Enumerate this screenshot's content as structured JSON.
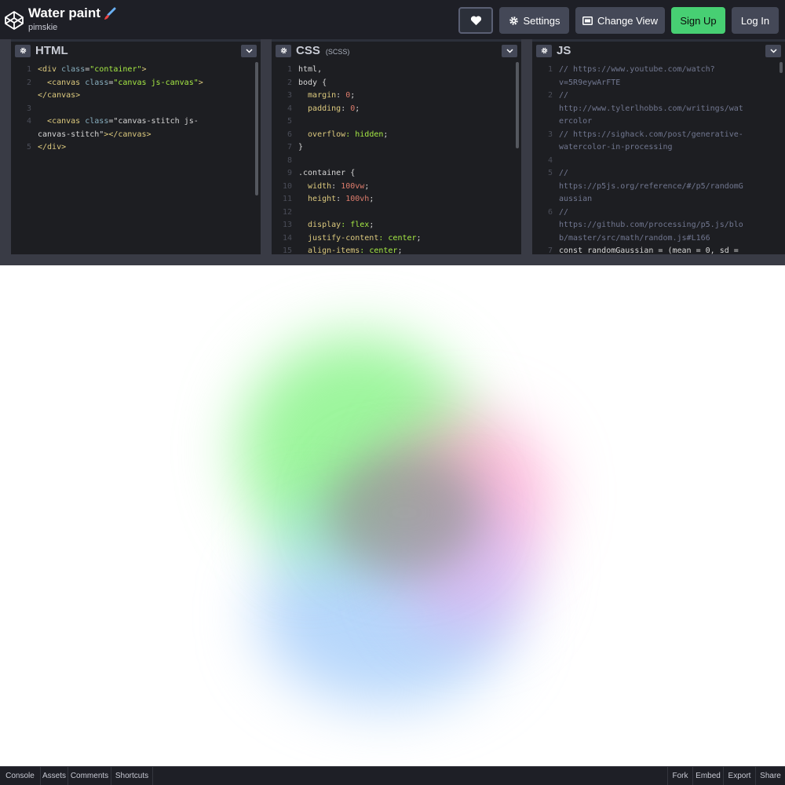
{
  "header": {
    "title": "Water paint",
    "author": "pimskie",
    "settings_label": "Settings",
    "change_view_label": "Change View",
    "signup_label": "Sign Up",
    "login_label": "Log In",
    "accent_green": "#47cf73"
  },
  "editors": {
    "html": {
      "label": "HTML",
      "lines": [
        {
          "n": "1",
          "t": "<div class=\"container\">"
        },
        {
          "n": "2",
          "t": "  <canvas class=\"canvas js-canvas\">"
        },
        {
          "n": "",
          "t": "</canvas>"
        },
        {
          "n": "3",
          "t": ""
        },
        {
          "n": "4",
          "t": "  <canvas class=\"canvas-stitch js-"
        },
        {
          "n": "",
          "t": "canvas-stitch\"></canvas>"
        },
        {
          "n": "5",
          "t": "</div>"
        }
      ]
    },
    "css": {
      "label": "CSS",
      "sub": "(SCSS)",
      "lines": [
        {
          "n": "1",
          "t": "html,"
        },
        {
          "n": "2",
          "t": "body {"
        },
        {
          "n": "3",
          "t": "  margin: 0;"
        },
        {
          "n": "4",
          "t": "  padding: 0;"
        },
        {
          "n": "5",
          "t": ""
        },
        {
          "n": "6",
          "t": "  overflow: hidden;"
        },
        {
          "n": "7",
          "t": "}"
        },
        {
          "n": "8",
          "t": ""
        },
        {
          "n": "9",
          "t": ".container {"
        },
        {
          "n": "10",
          "t": "  width: 100vw;"
        },
        {
          "n": "11",
          "t": "  height: 100vh;"
        },
        {
          "n": "12",
          "t": ""
        },
        {
          "n": "13",
          "t": "  display: flex;"
        },
        {
          "n": "14",
          "t": "  justify-content: center;"
        },
        {
          "n": "15",
          "t": "  align-items: center;"
        }
      ]
    },
    "js": {
      "label": "JS",
      "lines": [
        {
          "n": "1",
          "t": "// https://www.youtube.com/watch?"
        },
        {
          "n": "",
          "t": "v=5R9eywArFTE"
        },
        {
          "n": "2",
          "t": "//"
        },
        {
          "n": "",
          "t": "http://www.tylerlhobbs.com/writings/wat"
        },
        {
          "n": "",
          "t": "ercolor"
        },
        {
          "n": "3",
          "t": "// https://sighack.com/post/generative-"
        },
        {
          "n": "",
          "t": "watercolor-in-processing"
        },
        {
          "n": "4",
          "t": ""
        },
        {
          "n": "5",
          "t": "//"
        },
        {
          "n": "",
          "t": "https://p5js.org/reference/#/p5/randomG"
        },
        {
          "n": "",
          "t": "aussian"
        },
        {
          "n": "6",
          "t": "//"
        },
        {
          "n": "",
          "t": "https://github.com/processing/p5.js/blo"
        },
        {
          "n": "",
          "t": "b/master/src/math/random.js#L166"
        },
        {
          "n": "7",
          "t": "const randomGaussian = (mean = 0, sd ="
        }
      ]
    }
  },
  "footer": {
    "left": [
      "Console",
      "Assets",
      "Comments",
      "Shortcuts"
    ],
    "right": [
      "Fork",
      "Embed",
      "Export",
      "Share"
    ]
  }
}
